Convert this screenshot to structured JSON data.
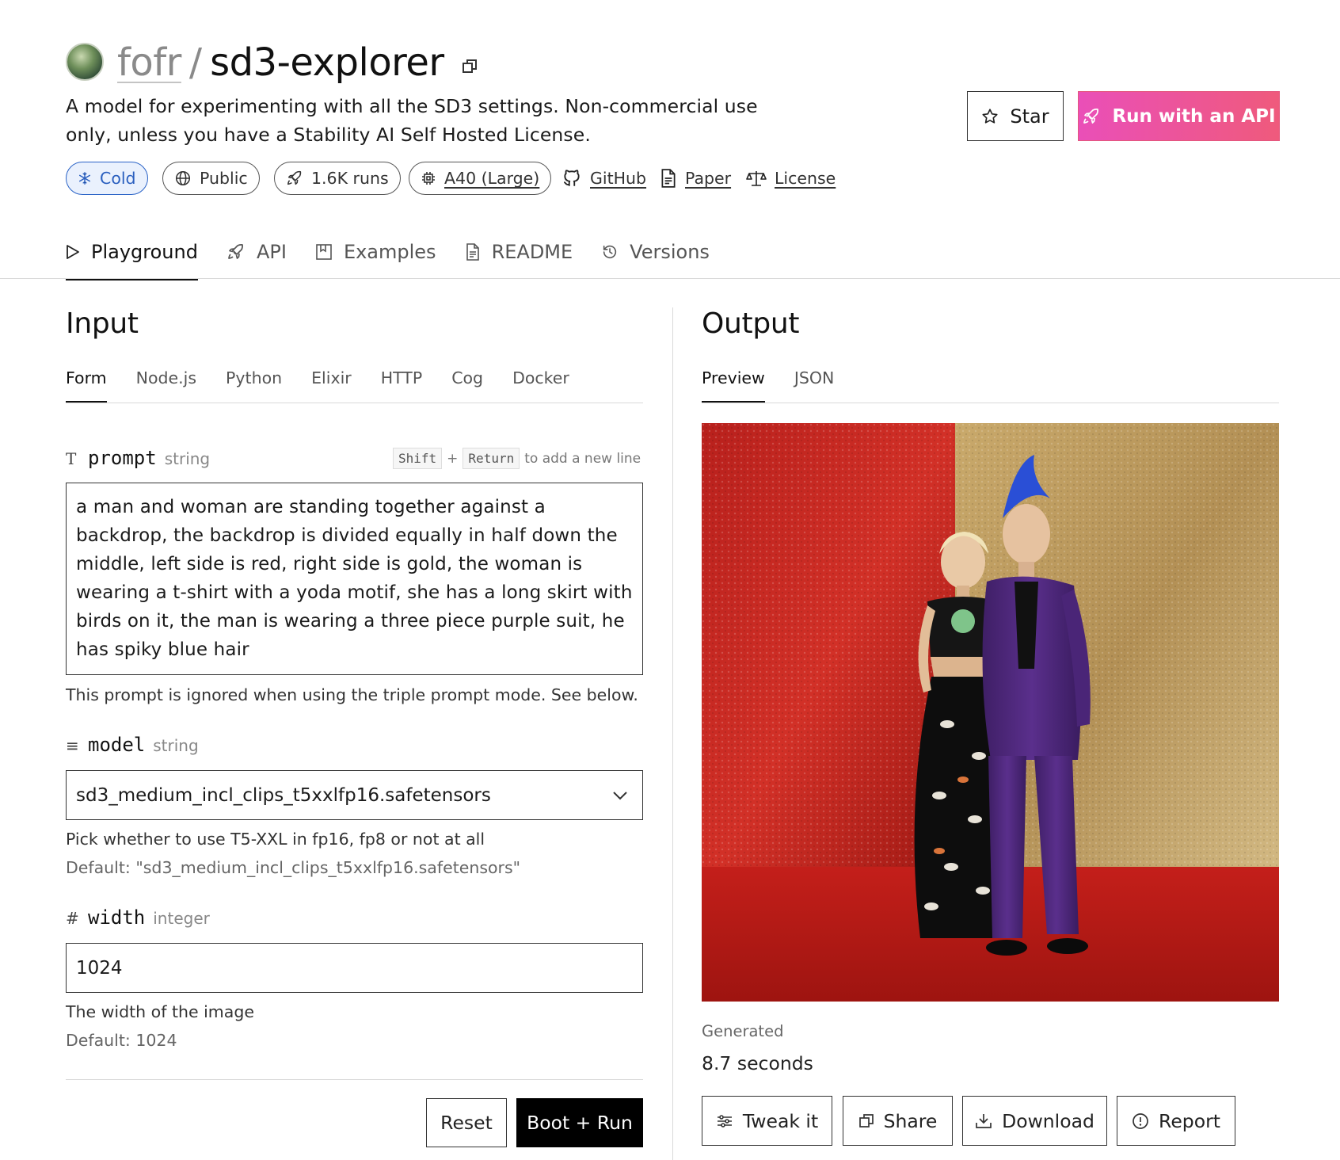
{
  "header": {
    "owner": "fofr",
    "separator": "/",
    "model_name": "sd3-explorer",
    "description": "A model for experimenting with all the SD3 settings. Non-commercial use only, unless you have a Stability AI Self Hosted License.",
    "star_label": "Star",
    "run_api_label": "Run with an API",
    "badges": {
      "cold": "Cold",
      "public": "Public",
      "runs": "1.6K runs",
      "hardware": "A40 (Large)"
    },
    "links": {
      "github": "GitHub",
      "paper": "Paper",
      "license": "License"
    }
  },
  "main_tabs": [
    "Playground",
    "API",
    "Examples",
    "README",
    "Versions"
  ],
  "input": {
    "title": "Input",
    "tabs": [
      "Form",
      "Node.js",
      "Python",
      "Elixir",
      "HTTP",
      "Cog",
      "Docker"
    ],
    "prompt": {
      "icon": "T",
      "name": "prompt",
      "type": "string",
      "hint_key1": "Shift",
      "hint_plus": "+",
      "hint_key2": "Return",
      "hint_text": "to add a new line",
      "value": "a man and woman are standing together against a backdrop, the backdrop is divided equally in half down the middle, left side is red, right side is gold, the woman is wearing a t-shirt with a yoda motif, she has a long skirt with birds on it, the man is wearing a three piece purple suit, he has spiky blue hair",
      "help": "This prompt is ignored when using the triple prompt mode. See below."
    },
    "model": {
      "icon": "≡",
      "name": "model",
      "type": "string",
      "value": "sd3_medium_incl_clips_t5xxlfp16.safetensors",
      "help": "Pick whether to use T5-XXL in fp16, fp8 or not at all",
      "default": "Default: \"sd3_medium_incl_clips_t5xxlfp16.safetensors\""
    },
    "width": {
      "icon": "#",
      "name": "width",
      "type": "integer",
      "value": "1024",
      "help": "The width of the image",
      "default": "Default: 1024"
    },
    "reset_label": "Reset",
    "run_label": "Boot + Run"
  },
  "output": {
    "title": "Output",
    "tabs": [
      "Preview",
      "JSON"
    ],
    "generated_label": "Generated",
    "generated_time": "8.7 seconds",
    "actions": {
      "tweak": "Tweak it",
      "share": "Share",
      "download": "Download",
      "report": "Report"
    }
  },
  "colors": {
    "accent_pink": "#ea4fb8",
    "accent_coral": "#ef5a7c",
    "cold_blue": "#2a63c7"
  }
}
